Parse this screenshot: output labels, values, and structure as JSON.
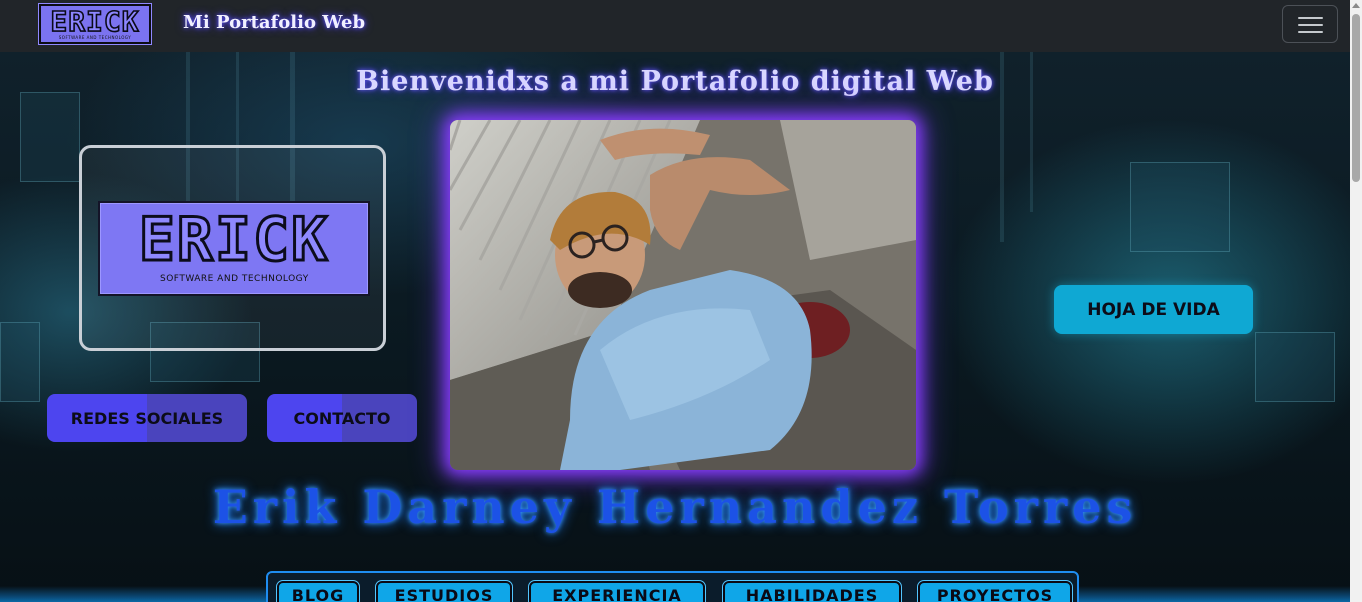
{
  "navbar": {
    "logo_word": "ERICK",
    "logo_tagline": "SOFTWARE AND TECHNOLOGY",
    "brand": "Mi Portafolio Web",
    "menu_icon": "hamburger-icon"
  },
  "hero": {
    "welcome": "Bienvenidxs a mi Portafolio digital Web",
    "logo_word": "ERICK",
    "logo_tagline": "SOFTWARE AND TECHNOLOGY",
    "buttons": {
      "redes": "REDES SOCIALES",
      "contacto": "CONTACTO",
      "hoja": "HOJA DE VIDA"
    },
    "name": "Erik Darney Hernandez Torres"
  },
  "sections": [
    "BLOG",
    "ESTUDIOS",
    "EXPERIENCIA",
    "HABILIDADES",
    "PROYECTOS"
  ],
  "colors": {
    "navbar_bg": "#212529",
    "accent_violet": "#4d45ef",
    "accent_cyan": "#0fa6e8",
    "name_blue": "#1c52e6",
    "photo_glow": "#8a3dff"
  }
}
